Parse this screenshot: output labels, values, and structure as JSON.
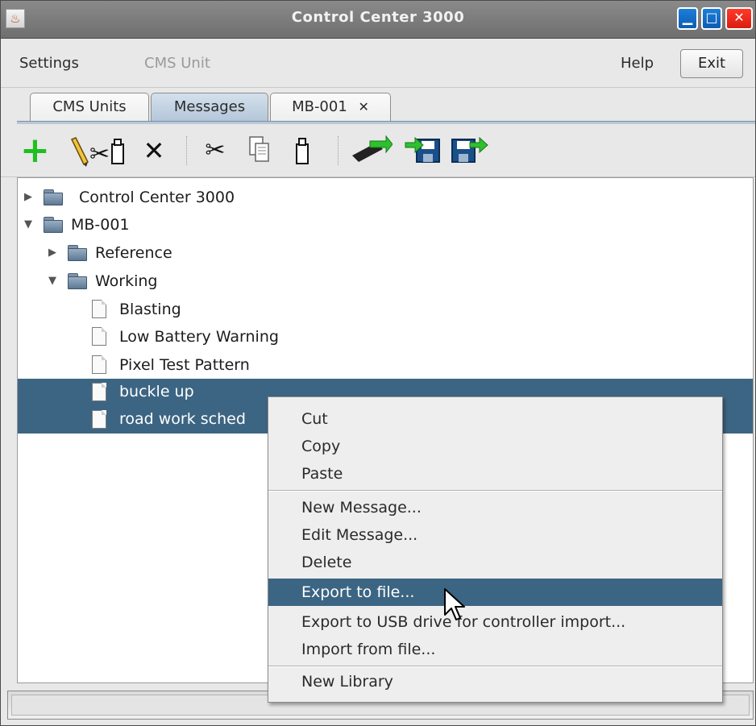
{
  "window": {
    "title": "Control Center 3000"
  },
  "menubar": {
    "settings": "Settings",
    "cms_unit": "CMS Unit",
    "help": "Help",
    "exit": "Exit"
  },
  "tabs": [
    {
      "label": "CMS Units"
    },
    {
      "label": "Messages"
    },
    {
      "label": "MB-001",
      "close_icon": "✕"
    }
  ],
  "toolbar": {
    "icons": [
      "add-icon",
      "edit-icon",
      "delete-icon",
      "cut-icon",
      "copy-icon",
      "paste-icon",
      "usb-export-icon",
      "import-icon",
      "export-icon"
    ]
  },
  "tree": {
    "root1": "Control Center 3000",
    "root2": "MB-001",
    "reference": "Reference",
    "working": "Working",
    "items": [
      "Blasting",
      "Low Battery Warning",
      "Pixel Test Pattern",
      "buckle up",
      "road work sched"
    ]
  },
  "context_menu": {
    "cut": "Cut",
    "copy": "Copy",
    "paste": "Paste",
    "new_message": "New Message...",
    "edit_message": "Edit Message...",
    "delete": "Delete",
    "export_file": "Export to file...",
    "export_usb": "Export to USB drive for controller import...",
    "import_file": "Import from file...",
    "new_library": "New Library"
  },
  "colors": {
    "selection": "#3c6583",
    "titlebar": "#7a7a7a",
    "add_green": "#1fbf1f"
  }
}
